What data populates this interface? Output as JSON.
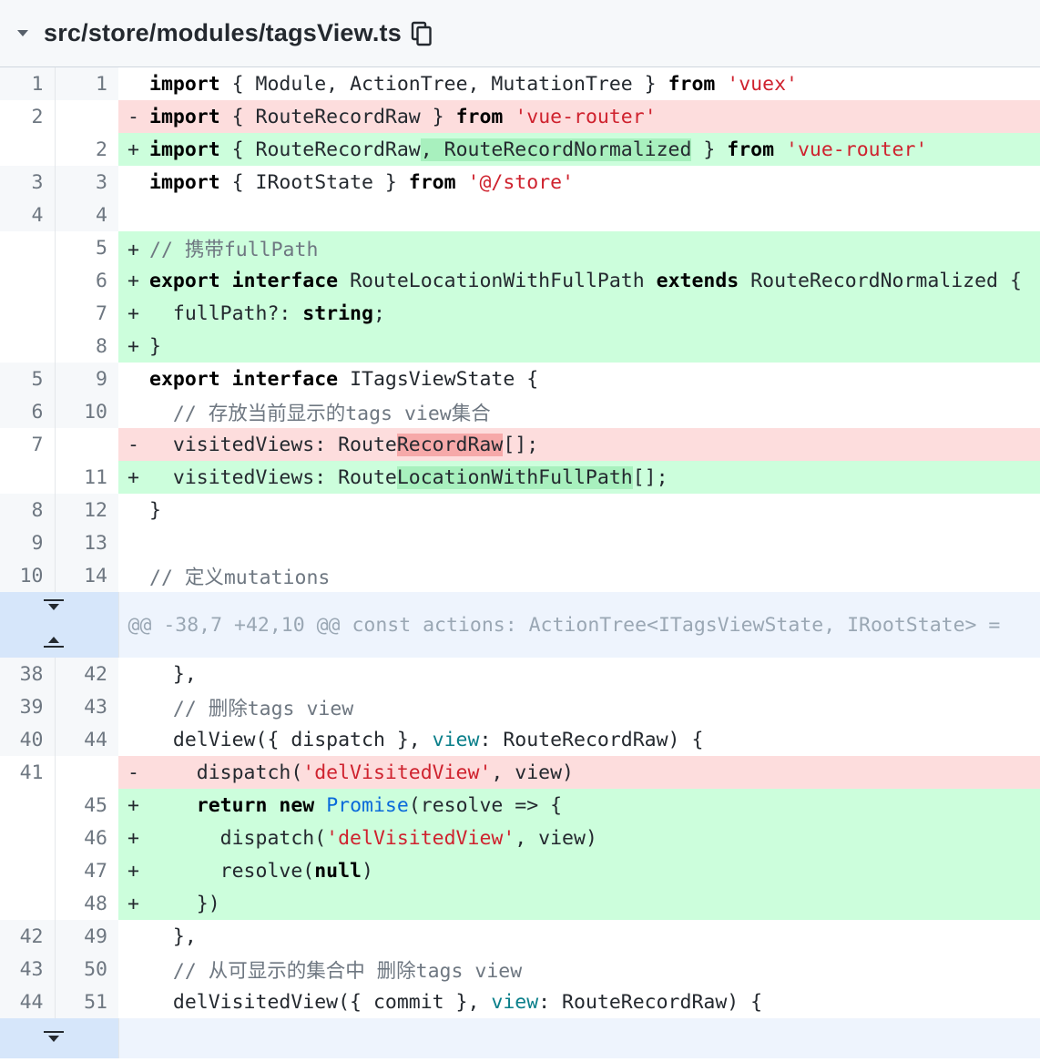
{
  "file": {
    "path": "src/store/modules/tagsView.ts"
  },
  "hunk_header": "@@ -38,7 +42,10 @@ const actions: ActionTree<ITagsViewState, IRootState> =",
  "colors": {
    "added": "#ccfedc",
    "removed": "#fddddd",
    "hunk": "#eef4fd"
  },
  "lines": [
    {
      "type": "ctx",
      "old": "1",
      "new": "1",
      "sign": " ",
      "tokens": [
        [
          "kw",
          "import"
        ],
        [
          "",
          "{ Module, ActionTree, MutationTree } "
        ],
        [
          "kw",
          "from"
        ],
        [
          "",
          " "
        ],
        [
          "str",
          "'vuex'"
        ]
      ]
    },
    {
      "type": "del",
      "old": "2",
      "new": "",
      "sign": "-",
      "tokens": [
        [
          "kw",
          "import"
        ],
        [
          "",
          "{ RouteRecordRaw } "
        ],
        [
          "kw",
          "from"
        ],
        [
          "",
          " "
        ],
        [
          "str",
          "'vue-router'"
        ]
      ]
    },
    {
      "type": "add",
      "old": "",
      "new": "2",
      "sign": "+",
      "tokens": [
        [
          "kw",
          "import"
        ],
        [
          "",
          "{ RouteRecordRaw"
        ],
        [
          "hl-add",
          ", RouteRecordNormalized"
        ],
        [
          "",
          " } "
        ],
        [
          "kw",
          "from"
        ],
        [
          "",
          " "
        ],
        [
          "str",
          "'vue-router'"
        ]
      ]
    },
    {
      "type": "ctx",
      "old": "3",
      "new": "3",
      "sign": " ",
      "tokens": [
        [
          "kw",
          "import"
        ],
        [
          "",
          "{ IRootState } "
        ],
        [
          "kw",
          "from"
        ],
        [
          "",
          " "
        ],
        [
          "str",
          "'@/store'"
        ]
      ]
    },
    {
      "type": "ctx",
      "old": "4",
      "new": "4",
      "sign": " ",
      "tokens": []
    },
    {
      "type": "add",
      "old": "",
      "new": "5",
      "sign": "+",
      "tokens": [
        [
          "cmt",
          "// 携带fullPath"
        ]
      ]
    },
    {
      "type": "add",
      "old": "",
      "new": "6",
      "sign": "+",
      "tokens": [
        [
          "kw",
          "export"
        ],
        [
          "",
          " "
        ],
        [
          "kw",
          "interface"
        ],
        [
          "",
          " RouteLocationWithFullPath "
        ],
        [
          "kw",
          "extends"
        ],
        [
          "",
          " RouteRecordNormalized {"
        ]
      ]
    },
    {
      "type": "add",
      "old": "",
      "new": "7",
      "sign": "+",
      "tokens": [
        [
          "",
          "  fullPath?: "
        ],
        [
          "kw",
          "string"
        ],
        [
          "",
          ";"
        ]
      ]
    },
    {
      "type": "add",
      "old": "",
      "new": "8",
      "sign": "+",
      "tokens": [
        [
          "",
          "}"
        ]
      ]
    },
    {
      "type": "ctx",
      "old": "5",
      "new": "9",
      "sign": " ",
      "tokens": [
        [
          "kw",
          "export"
        ],
        [
          "",
          " "
        ],
        [
          "kw",
          "interface"
        ],
        [
          "",
          " ITagsViewState {"
        ]
      ]
    },
    {
      "type": "ctx",
      "old": "6",
      "new": "10",
      "sign": " ",
      "tokens": [
        [
          "",
          "  "
        ],
        [
          "cmt",
          "// 存放当前显示的tags view集合"
        ]
      ]
    },
    {
      "type": "del",
      "old": "7",
      "new": "",
      "sign": "-",
      "tokens": [
        [
          "",
          "  visitedViews: Route"
        ],
        [
          "hl-del",
          "RecordRaw"
        ],
        [
          "",
          "[];"
        ]
      ]
    },
    {
      "type": "add",
      "old": "",
      "new": "11",
      "sign": "+",
      "tokens": [
        [
          "",
          "  visitedViews: Route"
        ],
        [
          "hl-add",
          "LocationWithFullPath"
        ],
        [
          "",
          "[];"
        ]
      ]
    },
    {
      "type": "ctx",
      "old": "8",
      "new": "12",
      "sign": " ",
      "tokens": [
        [
          "",
          "}"
        ]
      ]
    },
    {
      "type": "ctx",
      "old": "9",
      "new": "13",
      "sign": " ",
      "tokens": []
    },
    {
      "type": "ctx",
      "old": "10",
      "new": "14",
      "sign": " ",
      "tokens": [
        [
          "cmt",
          "// 定义mutations"
        ]
      ]
    },
    {
      "type": "hunk"
    },
    {
      "type": "ctx",
      "old": "38",
      "new": "42",
      "sign": " ",
      "tokens": [
        [
          "",
          "  },"
        ]
      ]
    },
    {
      "type": "ctx",
      "old": "39",
      "new": "43",
      "sign": " ",
      "tokens": [
        [
          "",
          "  "
        ],
        [
          "cmt",
          "// 删除tags view"
        ]
      ]
    },
    {
      "type": "ctx",
      "old": "40",
      "new": "44",
      "sign": " ",
      "tokens": [
        [
          "",
          "  delView({ dispatch }, "
        ],
        [
          "bi",
          "view"
        ],
        [
          "",
          ": RouteRecordRaw) {"
        ]
      ]
    },
    {
      "type": "del",
      "old": "41",
      "new": "",
      "sign": "-",
      "tokens": [
        [
          "",
          "    dispatch("
        ],
        [
          "str",
          "'delVisitedView'"
        ],
        [
          "",
          ", view)"
        ]
      ]
    },
    {
      "type": "add",
      "old": "",
      "new": "45",
      "sign": "+",
      "tokens": [
        [
          "",
          "    "
        ],
        [
          "kw",
          "return"
        ],
        [
          "",
          " "
        ],
        [
          "kw",
          "new"
        ],
        [
          "",
          " "
        ],
        [
          "cls",
          "Promise"
        ],
        [
          "",
          "(resolve => {"
        ]
      ]
    },
    {
      "type": "add",
      "old": "",
      "new": "46",
      "sign": "+",
      "tokens": [
        [
          "",
          "      dispatch("
        ],
        [
          "str",
          "'delVisitedView'"
        ],
        [
          "",
          ", view)"
        ]
      ]
    },
    {
      "type": "add",
      "old": "",
      "new": "47",
      "sign": "+",
      "tokens": [
        [
          "",
          "      resolve("
        ],
        [
          "kw",
          "null"
        ],
        [
          "",
          ")"
        ]
      ]
    },
    {
      "type": "add",
      "old": "",
      "new": "48",
      "sign": "+",
      "tokens": [
        [
          "",
          "    })"
        ]
      ]
    },
    {
      "type": "ctx",
      "old": "42",
      "new": "49",
      "sign": " ",
      "tokens": [
        [
          "",
          "  },"
        ]
      ]
    },
    {
      "type": "ctx",
      "old": "43",
      "new": "50",
      "sign": " ",
      "tokens": [
        [
          "",
          "  "
        ],
        [
          "cmt",
          "// 从可显示的集合中 删除tags view"
        ]
      ]
    },
    {
      "type": "ctx",
      "old": "44",
      "new": "51",
      "sign": " ",
      "tokens": [
        [
          "",
          "  delVisitedView({ commit }, "
        ],
        [
          "bi",
          "view"
        ],
        [
          "",
          ": RouteRecordRaw) {"
        ]
      ]
    },
    {
      "type": "hunk-end"
    }
  ]
}
